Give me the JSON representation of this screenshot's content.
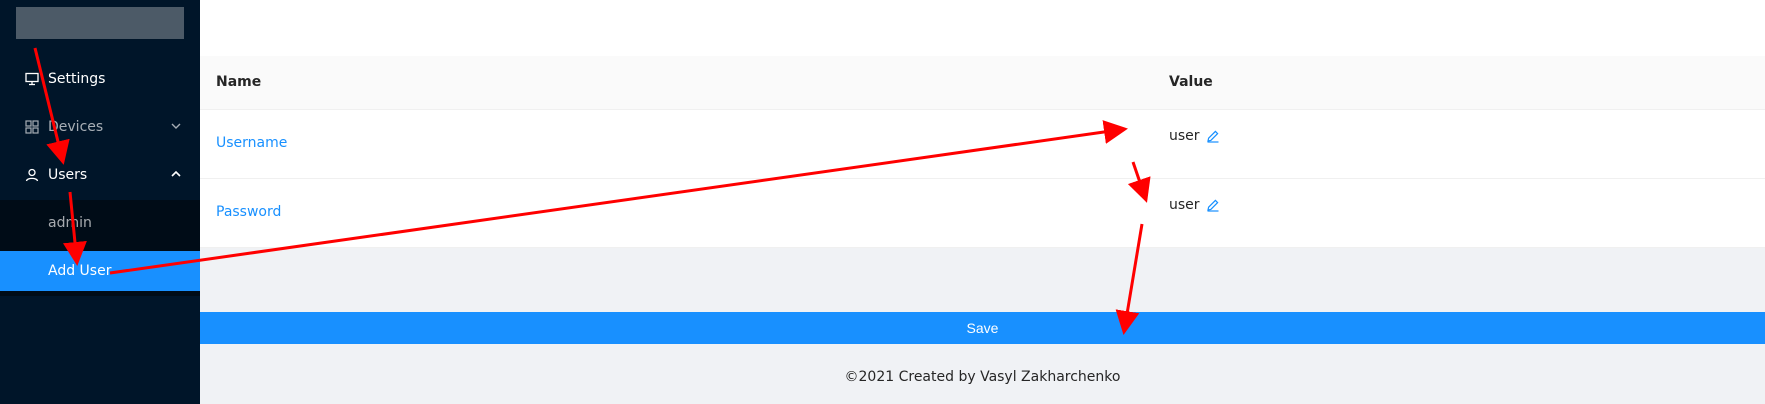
{
  "sidebar": {
    "items": [
      {
        "label": "Settings",
        "icon": "desktop-icon"
      },
      {
        "label": "Devices",
        "icon": "appstore-icon",
        "chevron": "chevron-down-icon"
      },
      {
        "label": "Users",
        "icon": "user-icon",
        "chevron": "chevron-up-icon"
      }
    ],
    "users_submenu": [
      {
        "label": "admin"
      },
      {
        "label": "Add User",
        "selected": true
      }
    ]
  },
  "table": {
    "columns": [
      "Name",
      "Value"
    ],
    "rows": [
      {
        "name": "Username",
        "value": "user"
      },
      {
        "name": "Password",
        "value": "user"
      }
    ]
  },
  "save_label": "Save",
  "footer": "©2021 Created by Vasyl Zakharchenko",
  "colors": {
    "sidebar_bg": "#001529",
    "submenu_bg": "#000c17",
    "accent": "#1890ff",
    "annotation_arrow": "#ff0000"
  }
}
